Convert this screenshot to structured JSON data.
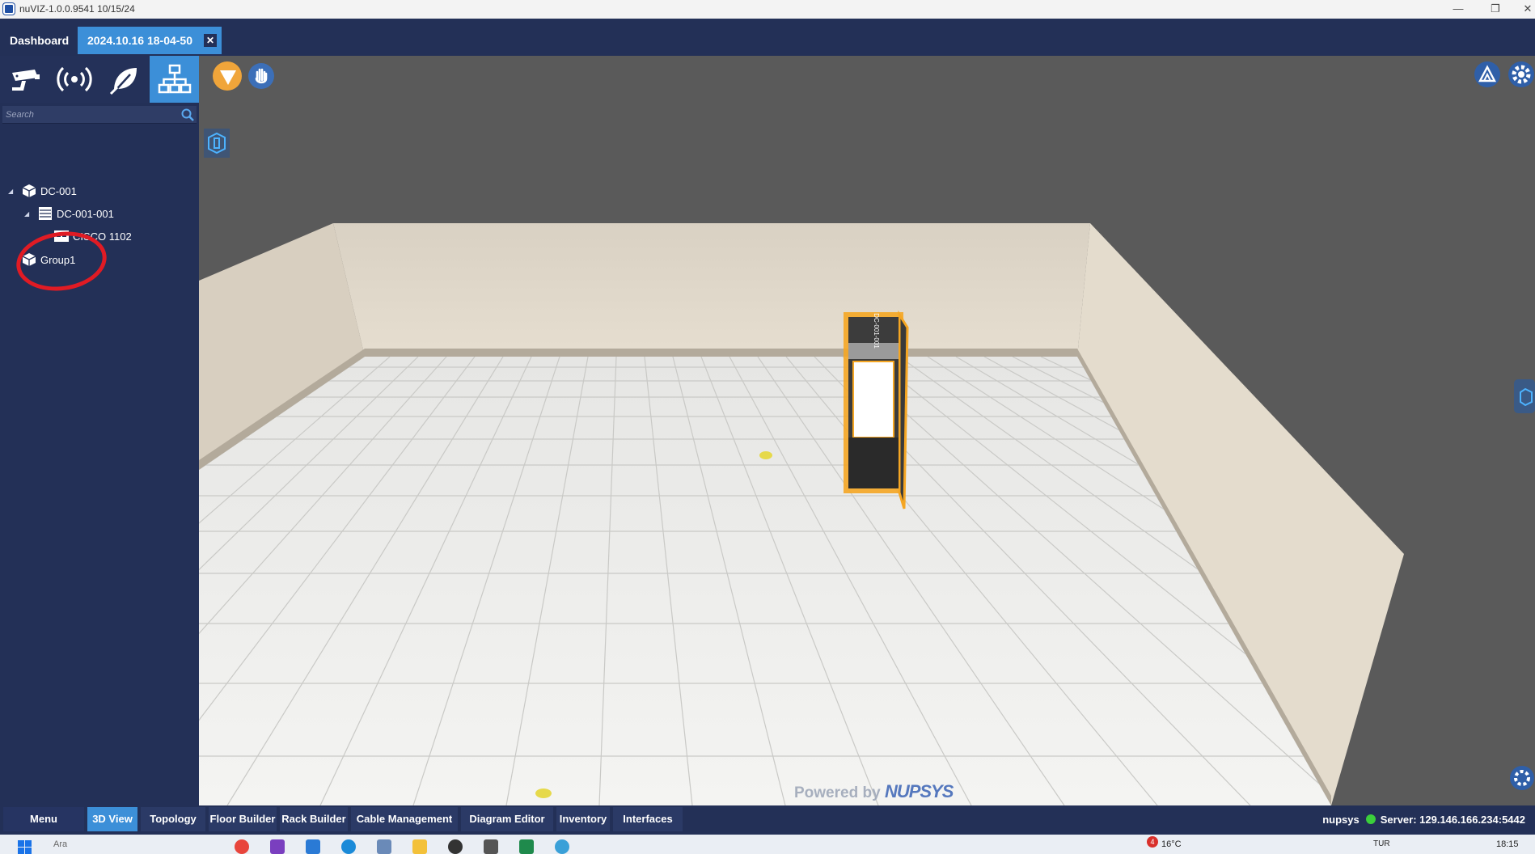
{
  "window": {
    "title": "nuVIZ-1.0.0.9541 10/15/24",
    "minimize": "—",
    "restore": "❐",
    "close": "✕"
  },
  "tabs": [
    {
      "label": "Dashboard"
    },
    {
      "label": "2024.10.16 18-04-50",
      "close": "✕"
    }
  ],
  "left_panel": {
    "modes": [
      {
        "icon": "security-camera-icon",
        "active": false
      },
      {
        "icon": "wireless-signal-icon",
        "active": false
      },
      {
        "icon": "leaf-icon",
        "active": false
      },
      {
        "icon": "network-hierarchy-icon",
        "active": true
      }
    ],
    "search": {
      "placeholder": "Search",
      "value": ""
    },
    "tree": [
      {
        "label": "DC-001",
        "level": 0,
        "expanded": true,
        "icon": "datacenter-cube-icon"
      },
      {
        "label": "DC-001-001",
        "level": 1,
        "expanded": true,
        "icon": "rack-icon"
      },
      {
        "label": "CISCO 1102",
        "level": 2,
        "expanded": false,
        "icon": "device-icon"
      },
      {
        "label": "Group1",
        "level": 0,
        "expanded": false,
        "icon": "group-cube-icon"
      }
    ]
  },
  "viewport": {
    "rack_label": "DC-001-001",
    "watermark_prefix": "Powered by",
    "watermark_brand": "NUPSYS"
  },
  "bottom_nav": {
    "items": [
      {
        "label": "Menu",
        "active": false
      },
      {
        "label": "3D View",
        "active": true
      },
      {
        "label": "Topology",
        "active": false
      },
      {
        "label": "Floor Builder",
        "active": false
      },
      {
        "label": "Rack Builder",
        "active": false
      },
      {
        "label": "Cable Management",
        "active": false
      },
      {
        "label": "Diagram Editor",
        "active": false
      },
      {
        "label": "Inventory",
        "active": false
      },
      {
        "label": "Interfaces",
        "active": false
      }
    ],
    "user": "nupsys",
    "server": "Server: 129.146.166.234:5442"
  },
  "taskbar": {
    "search_text": "Ara",
    "weather": "16°C",
    "notification_count": "4",
    "language": "TUR",
    "time": "18:15"
  },
  "colors": {
    "panel": "#233057",
    "accent": "#3c8fd8",
    "highlight": "#f5a623",
    "annotation": "#e01b24",
    "online": "#3bcf3b"
  }
}
